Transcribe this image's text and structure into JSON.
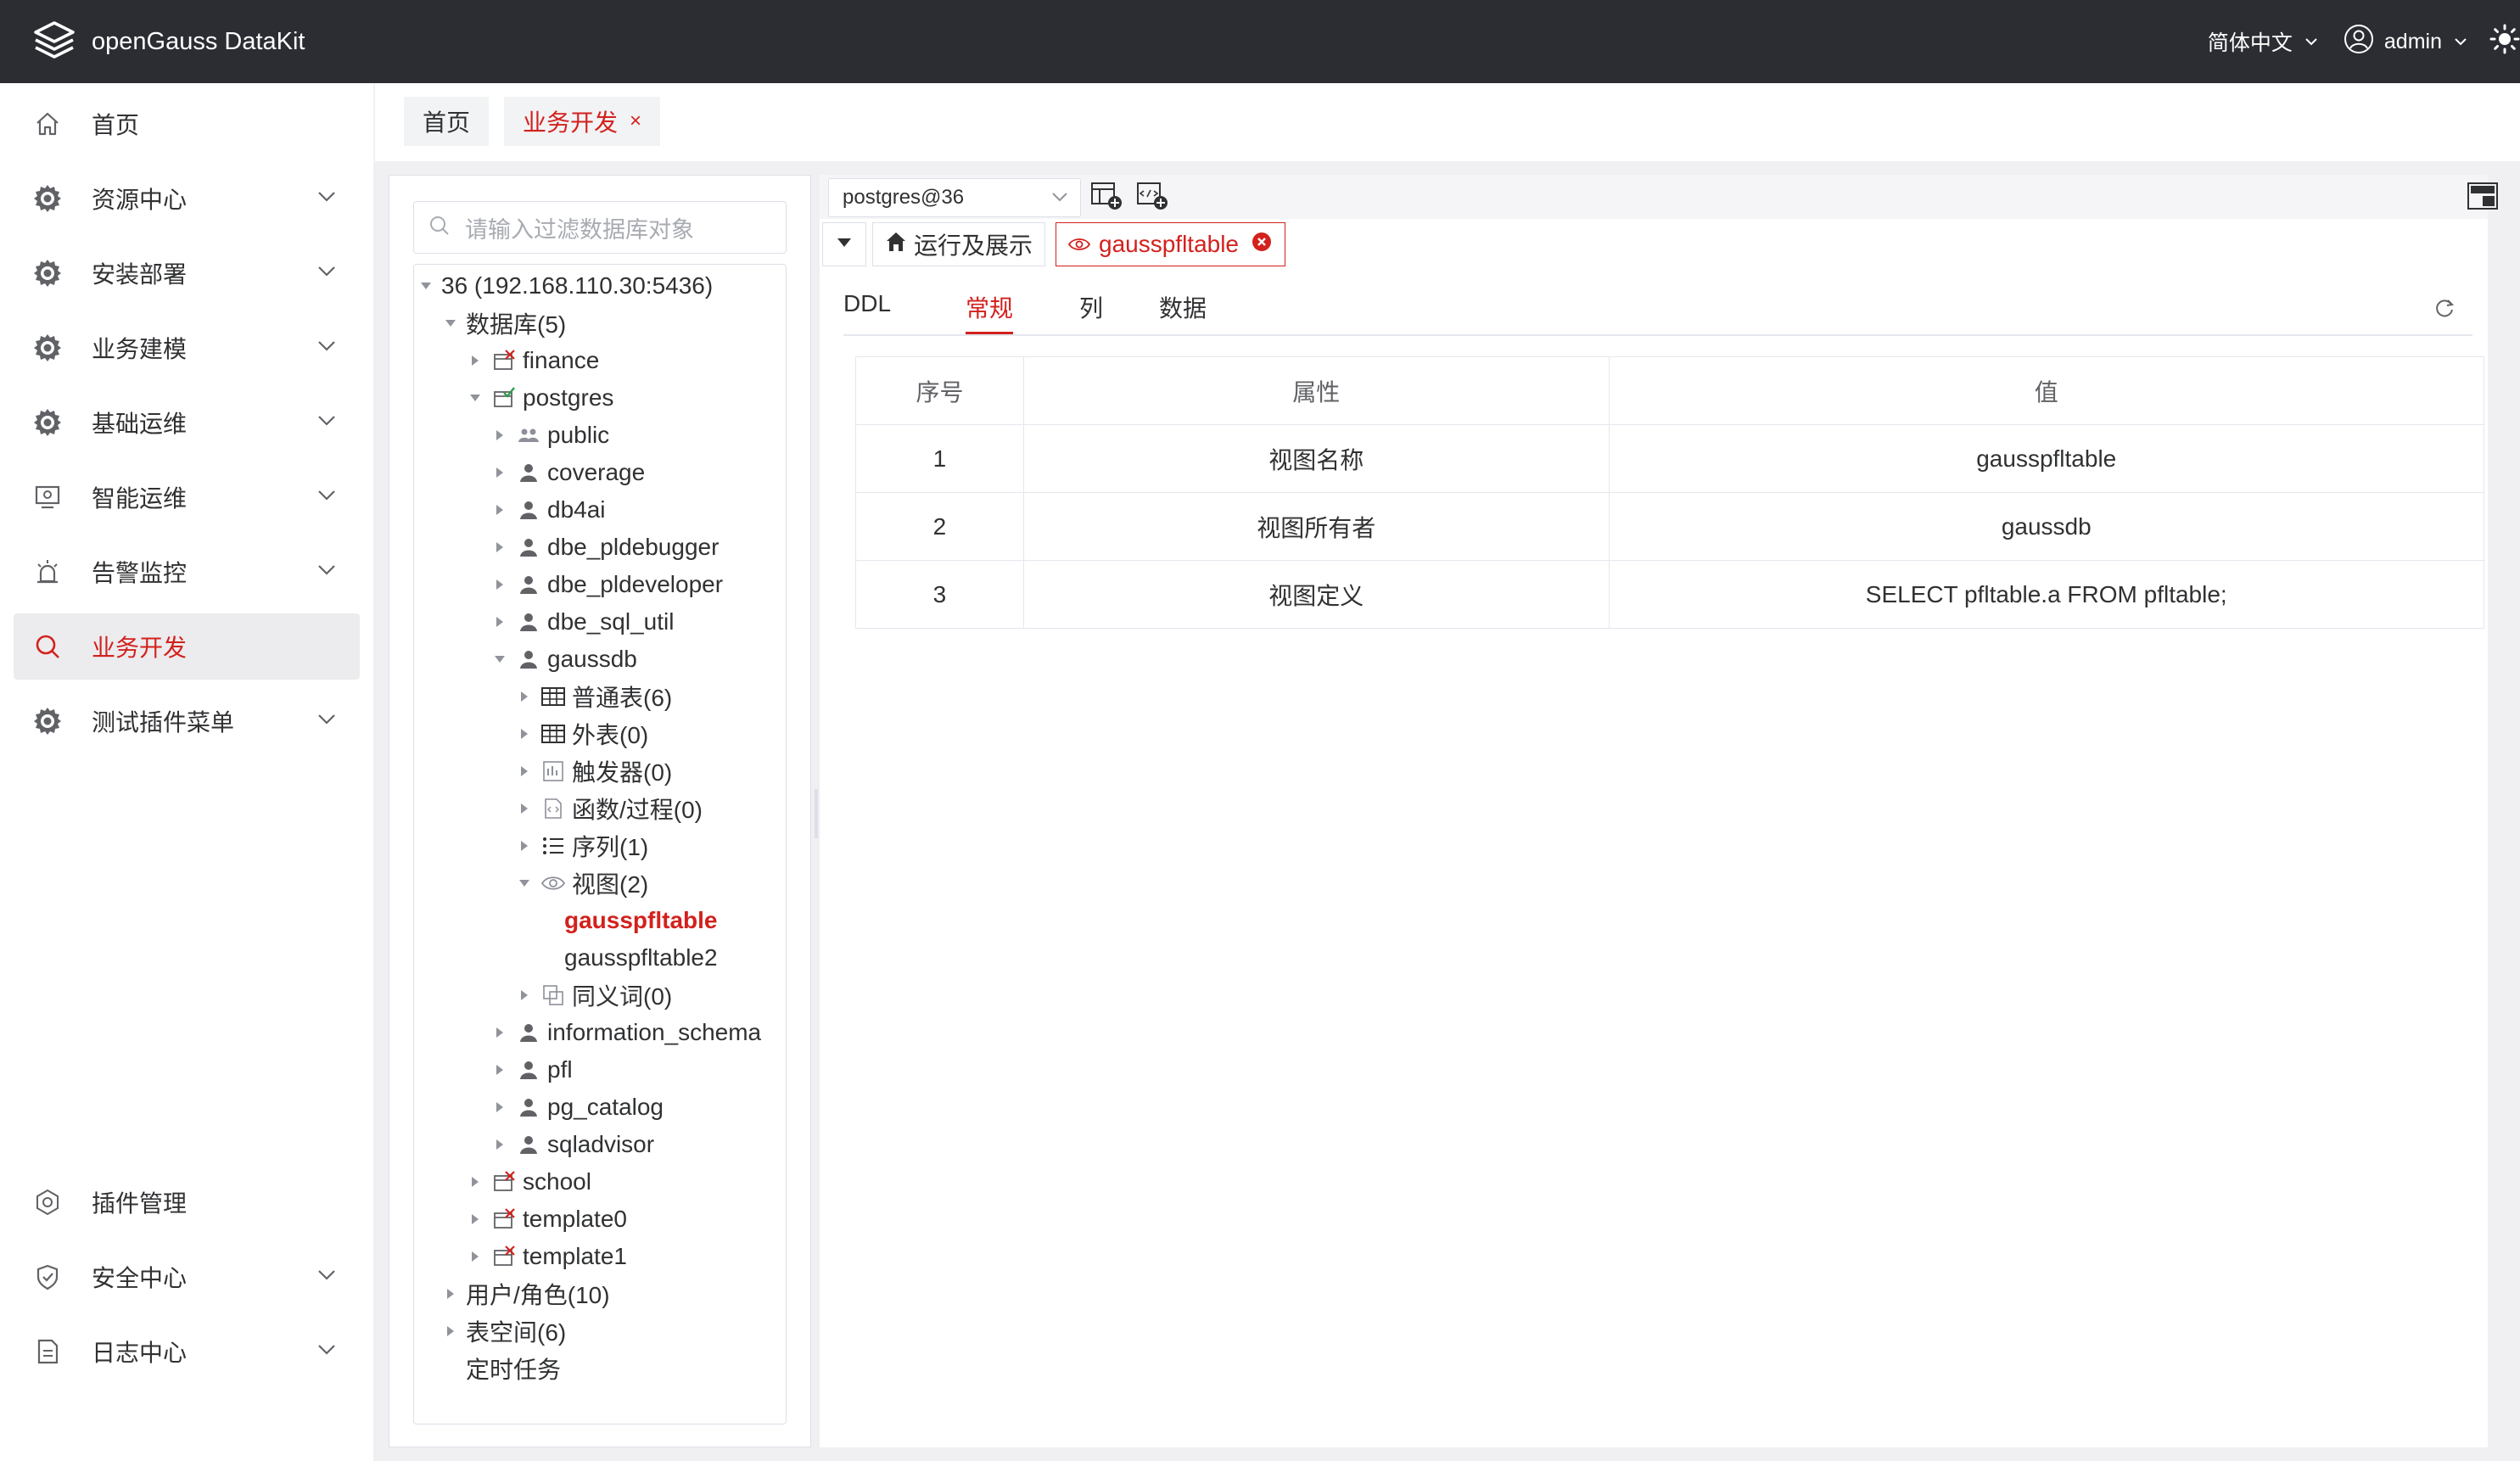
{
  "header": {
    "app_title": "openGauss DataKit",
    "language": "简体中文",
    "user": "admin"
  },
  "sidebar": {
    "items": [
      {
        "label": "首页",
        "icon": "home-icon",
        "expandable": false,
        "active": false
      },
      {
        "label": "资源中心",
        "icon": "gear-icon",
        "expandable": true,
        "active": false
      },
      {
        "label": "安装部署",
        "icon": "gear-icon",
        "expandable": true,
        "active": false
      },
      {
        "label": "业务建模",
        "icon": "gear-icon",
        "expandable": true,
        "active": false
      },
      {
        "label": "基础运维",
        "icon": "gear-icon",
        "expandable": true,
        "active": false
      },
      {
        "label": "智能运维",
        "icon": "monitor-icon",
        "expandable": true,
        "active": false
      },
      {
        "label": "告警监控",
        "icon": "alarm-icon",
        "expandable": true,
        "active": false
      },
      {
        "label": "业务开发",
        "icon": "search-icon",
        "expandable": false,
        "active": true
      },
      {
        "label": "测试插件菜单",
        "icon": "gear-icon",
        "expandable": true,
        "active": false
      }
    ],
    "bottom_items": [
      {
        "label": "插件管理",
        "icon": "plugin-icon",
        "expandable": false
      },
      {
        "label": "安全中心",
        "icon": "shield-icon",
        "expandable": true
      },
      {
        "label": "日志中心",
        "icon": "document-icon",
        "expandable": true
      }
    ]
  },
  "tabs": {
    "home": "首页",
    "business": "业务开发",
    "close": "×"
  },
  "filter": {
    "placeholder": "请输入过滤数据库对象"
  },
  "tree": [
    {
      "label": "36 (192.168.110.30:5436)",
      "level": 0,
      "arrow": "down",
      "icon": "none"
    },
    {
      "label": "数据库(5)",
      "level": 1,
      "arrow": "down",
      "icon": "none"
    },
    {
      "label": "finance",
      "level": 2,
      "arrow": "right",
      "icon": "db-off"
    },
    {
      "label": "postgres",
      "level": 2,
      "arrow": "down",
      "icon": "db-on"
    },
    {
      "label": "public",
      "level": 3,
      "arrow": "right",
      "icon": "group"
    },
    {
      "label": "coverage",
      "level": 3,
      "arrow": "right",
      "icon": "user"
    },
    {
      "label": "db4ai",
      "level": 3,
      "arrow": "right",
      "icon": "user"
    },
    {
      "label": "dbe_pldebugger",
      "level": 3,
      "arrow": "right",
      "icon": "user"
    },
    {
      "label": "dbe_pldeveloper",
      "level": 3,
      "arrow": "right",
      "icon": "user"
    },
    {
      "label": "dbe_sql_util",
      "level": 3,
      "arrow": "right",
      "icon": "user"
    },
    {
      "label": "gaussdb",
      "level": 3,
      "arrow": "down",
      "icon": "user"
    },
    {
      "label": "普通表(6)",
      "level": 4,
      "arrow": "right",
      "icon": "table"
    },
    {
      "label": "外表(0)",
      "level": 4,
      "arrow": "right",
      "icon": "table"
    },
    {
      "label": "触发器(0)",
      "level": 4,
      "arrow": "right",
      "icon": "trigger"
    },
    {
      "label": "函数/过程(0)",
      "level": 4,
      "arrow": "right",
      "icon": "function"
    },
    {
      "label": "序列(1)",
      "level": 4,
      "arrow": "right",
      "icon": "sequence"
    },
    {
      "label": "视图(2)",
      "level": 4,
      "arrow": "down",
      "icon": "eye"
    },
    {
      "label": "gausspfltable",
      "level": 5,
      "arrow": "none",
      "icon": "none",
      "selected": true
    },
    {
      "label": "gausspfltable2",
      "level": 5,
      "arrow": "none",
      "icon": "none"
    },
    {
      "label": "同义词(0)",
      "level": 4,
      "arrow": "right",
      "icon": "synonym"
    },
    {
      "label": "information_schema",
      "level": 3,
      "arrow": "right",
      "icon": "user"
    },
    {
      "label": "pfl",
      "level": 3,
      "arrow": "right",
      "icon": "user"
    },
    {
      "label": "pg_catalog",
      "level": 3,
      "arrow": "right",
      "icon": "user"
    },
    {
      "label": "sqladvisor",
      "level": 3,
      "arrow": "right",
      "icon": "user"
    },
    {
      "label": "school",
      "level": 2,
      "arrow": "right",
      "icon": "db-off"
    },
    {
      "label": "template0",
      "level": 2,
      "arrow": "right",
      "icon": "db-off"
    },
    {
      "label": "template1",
      "level": 2,
      "arrow": "right",
      "icon": "db-off"
    },
    {
      "label": "用户/角色(10)",
      "level": 1,
      "arrow": "right",
      "icon": "none"
    },
    {
      "label": "表空间(6)",
      "level": 1,
      "arrow": "right",
      "icon": "none"
    },
    {
      "label": "定时任务",
      "level": 1,
      "arrow": "none",
      "icon": "none"
    }
  ],
  "toolbar": {
    "connection": "postgres@36"
  },
  "query_tabs": {
    "run": "运行及展示",
    "view": "gausspfltable"
  },
  "subtabs": [
    {
      "label": "DDL",
      "active": false
    },
    {
      "label": "常规",
      "active": true
    },
    {
      "label": "列",
      "active": false
    },
    {
      "label": "数据",
      "active": false
    }
  ],
  "table": {
    "headers": [
      "序号",
      "属性",
      "值"
    ],
    "rows": [
      [
        "1",
        "视图名称",
        "gausspfltable"
      ],
      [
        "2",
        "视图所有者",
        "gaussdb"
      ],
      [
        "3",
        "视图定义",
        "SELECT pfltable.a FROM pfltable;"
      ]
    ]
  },
  "colors": {
    "accent": "#d3211d",
    "header_bg": "#2b2d33"
  }
}
